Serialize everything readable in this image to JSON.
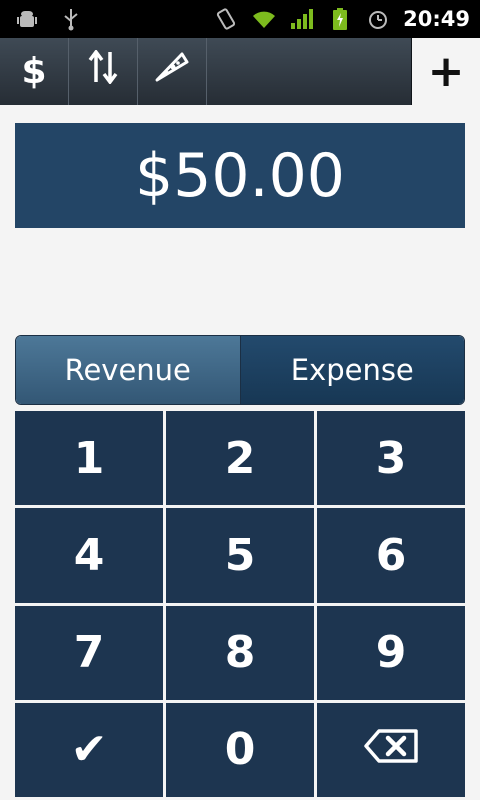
{
  "status_bar": {
    "time": "20:49",
    "icons": [
      "android-debug-icon",
      "usb-icon",
      "vibrate-icon",
      "wifi-icon",
      "signal-icon",
      "battery-charging-icon",
      "alarm-icon"
    ]
  },
  "toolbar": {
    "buttons": [
      {
        "name": "dollar-icon",
        "glyph": "$"
      },
      {
        "name": "sort-arrows-icon",
        "glyph": "⇅"
      },
      {
        "name": "pizza-slice-icon",
        "glyph": "🍕"
      }
    ],
    "add_glyph": "+"
  },
  "amount": {
    "value": "$50.00"
  },
  "toggle": {
    "revenue_label": "Revenue",
    "expense_label": "Expense"
  },
  "keypad": {
    "keys": [
      "1",
      "2",
      "3",
      "4",
      "5",
      "6",
      "7",
      "8",
      "9",
      "✔",
      "0",
      "⌫"
    ]
  }
}
